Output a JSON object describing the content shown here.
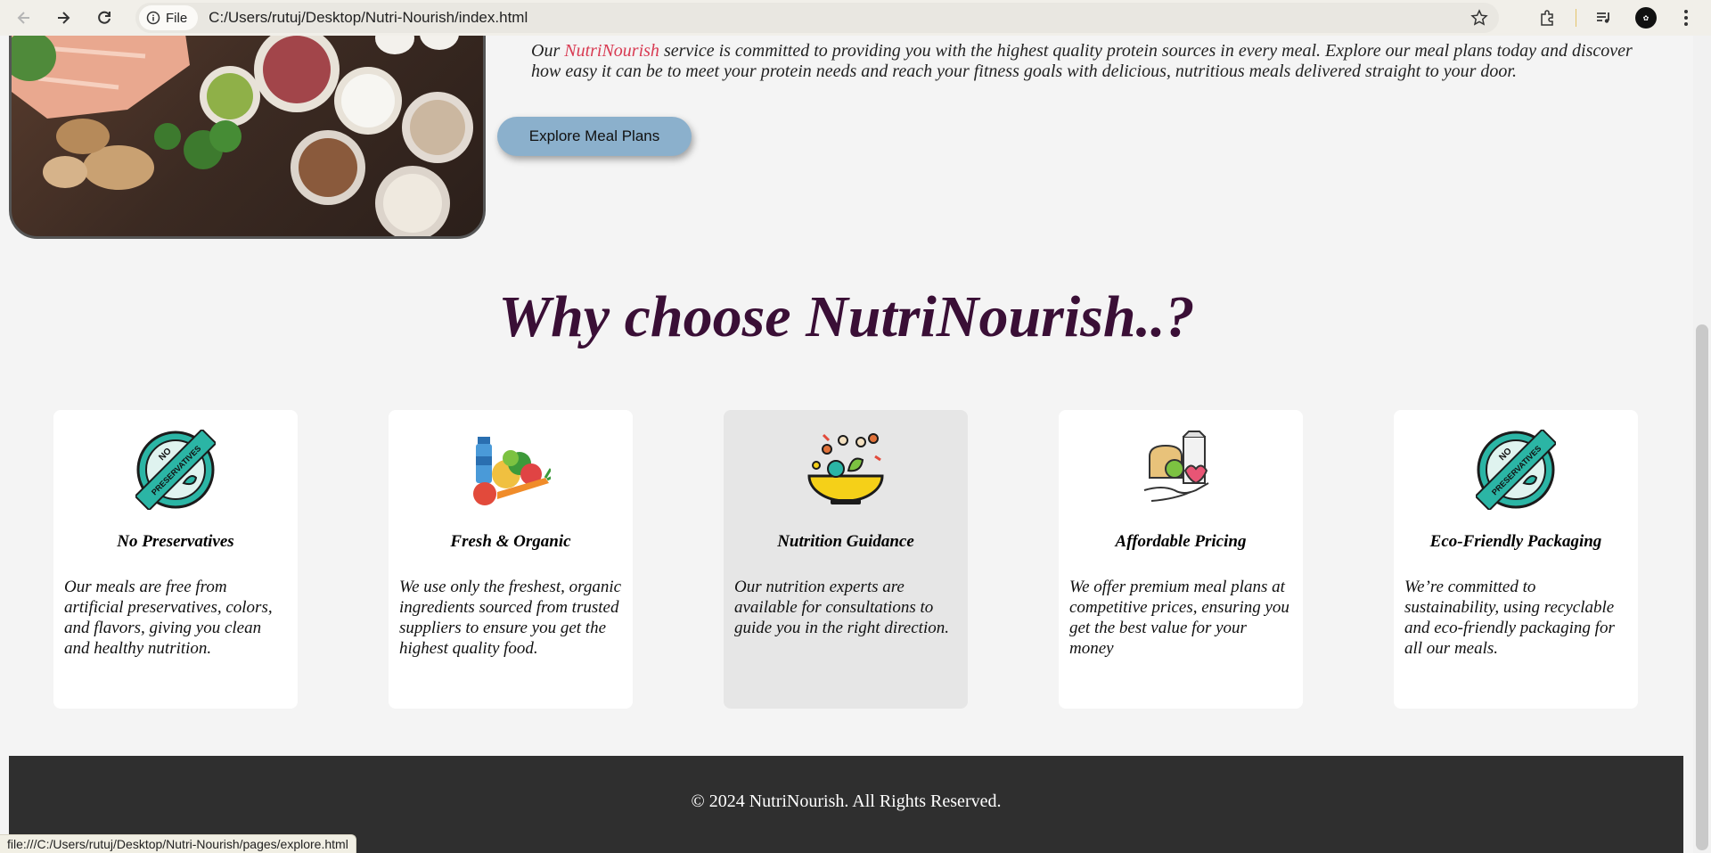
{
  "browser": {
    "site_chip": "File",
    "url": "C:/Users/rutuj/Desktop/Nutri-Nourish/index.html",
    "status_url": "file:///C:/Users/rutuj/Desktop/Nutri-Nourish/pages/explore.html",
    "icons": [
      "back-icon",
      "forward-icon",
      "reload-icon",
      "info-icon",
      "star-icon",
      "extensions-icon",
      "media-icon",
      "avatar",
      "menu-icon"
    ]
  },
  "hero": {
    "text_before": "Our ",
    "brand": "NutriNourish",
    "text_after": " service is committed to providing you with the highest quality protein sources in every meal. Explore our meal plans today and discover how easy it can be to meet your protein needs and reach your fitness goals with delicious, nutritious meals delivered straight to your door.",
    "button_label": "Explore Meal Plans"
  },
  "features": {
    "title": "Why choose NutriNourish..?",
    "cards": [
      {
        "title": "No Preservatives",
        "desc": "Our meals are free from artificial preservatives, colors, and flavors, giving you clean and healthy nutrition.",
        "icon": "no-preservatives-icon"
      },
      {
        "title": "Fresh & Organic",
        "desc": "We use only the freshest, organic ingredients sourced from trusted suppliers to ensure you get the highest quality food.",
        "icon": "fresh-food-icon"
      },
      {
        "title": "Nutrition Guidance",
        "desc": "Our nutrition experts are available for consultations to guide you in the right direction.",
        "icon": "salad-bowl-icon"
      },
      {
        "title": "Affordable Pricing",
        "desc": "We offer premium meal plans at competitive prices, ensuring you get the best value for your money",
        "icon": "hand-food-icon"
      },
      {
        "title": "Eco-Friendly Packaging",
        "desc": "We’re committed to sustainability, using recyclable and eco-friendly packaging for all our meals.",
        "icon": "no-preservatives-icon"
      }
    ]
  },
  "footer": {
    "text": "© 2024 NutriNourish. All Rights Reserved."
  },
  "badge_text": {
    "top": "NO",
    "band": "PRESERVATIVES"
  },
  "colors": {
    "title": "#3a0f36",
    "brand": "#d83a52",
    "button": "#8bb0cc",
    "footer": "#2f2f2f",
    "badge": "#2bb5a5"
  }
}
